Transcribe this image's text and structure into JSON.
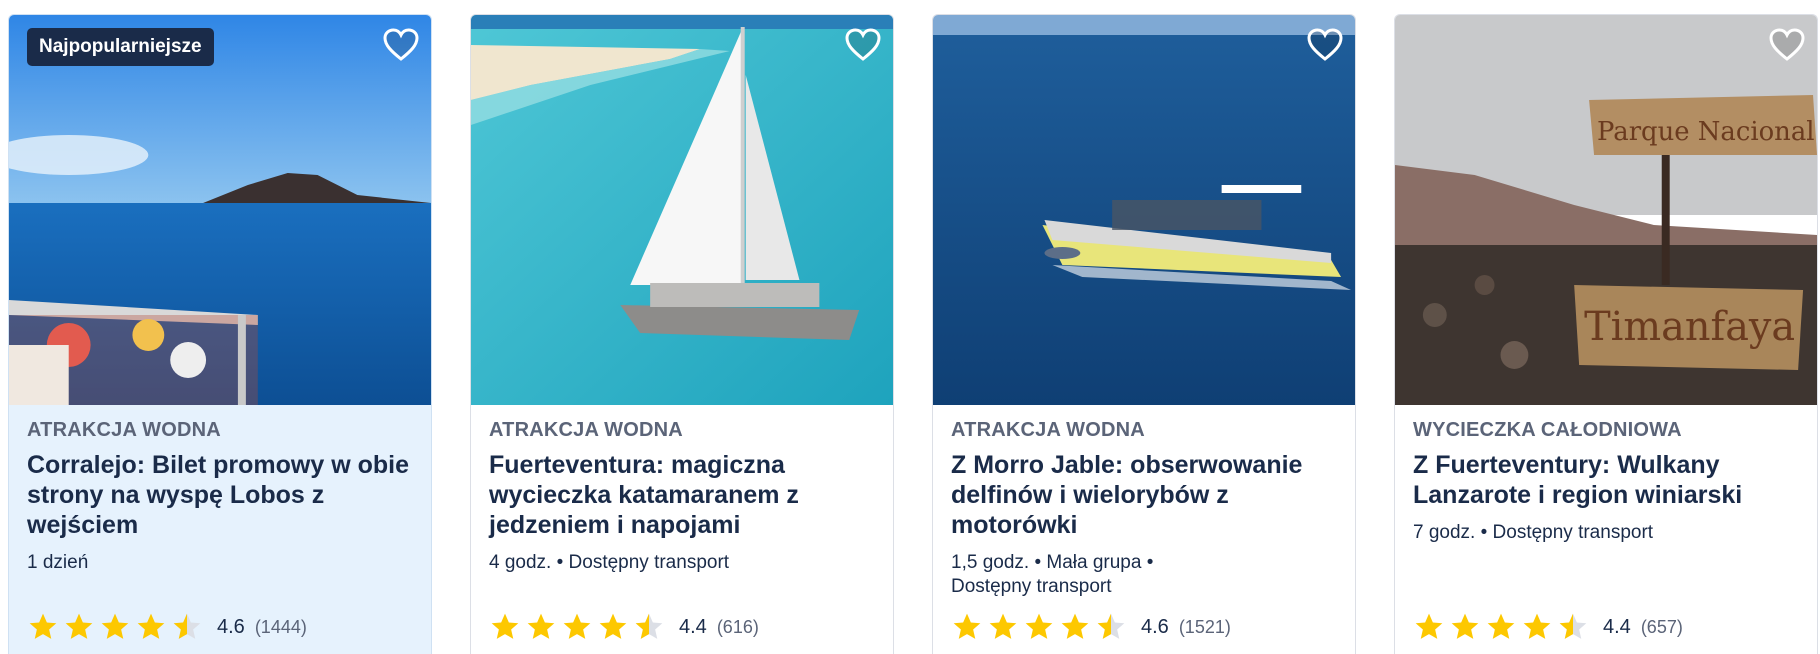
{
  "colors": {
    "star": "#fdc800",
    "star_empty": "#dcdfe6",
    "badge_bg": "#1a2b49",
    "highlight_bg": "#e6f2fd"
  },
  "cards": [
    {
      "badge": "Najpopularniejsze",
      "category": "ATRAKCJA WODNA",
      "title": "Corralejo: Bilet promowy w obie strony na wyspę Lobos z wejściem",
      "meta": "1 dzień",
      "rating": "4.6",
      "reviews": "(1444)",
      "favorite_icon": "heart-icon"
    },
    {
      "category": "ATRAKCJA WODNA",
      "title": "Fuerteventura: magiczna wycieczka katamaranem z jedzeniem i napojami",
      "meta": "4 godz. • Dostępny transport",
      "rating": "4.4",
      "reviews": "(616)",
      "favorite_icon": "heart-icon"
    },
    {
      "category": "ATRAKCJA WODNA",
      "title": "Z Morro Jable: obserwowanie delfinów i wielorybów z motorówki",
      "meta": "1,5 godz. • Mała grupa • Dostępny transport",
      "rating": "4.6",
      "reviews": "(1521)",
      "favorite_icon": "heart-icon"
    },
    {
      "category": "WYCIECZKA CAŁODNIOWA",
      "title": "Z Fuerteventury: Wulkany Lanzarote i region winiarski",
      "meta": "7 godz. • Dostępny transport",
      "rating": "4.4",
      "reviews": "(657)",
      "favorite_icon": "heart-icon",
      "sign_text": "Parque Nacional",
      "sign_text2": "Timanfaya"
    }
  ]
}
